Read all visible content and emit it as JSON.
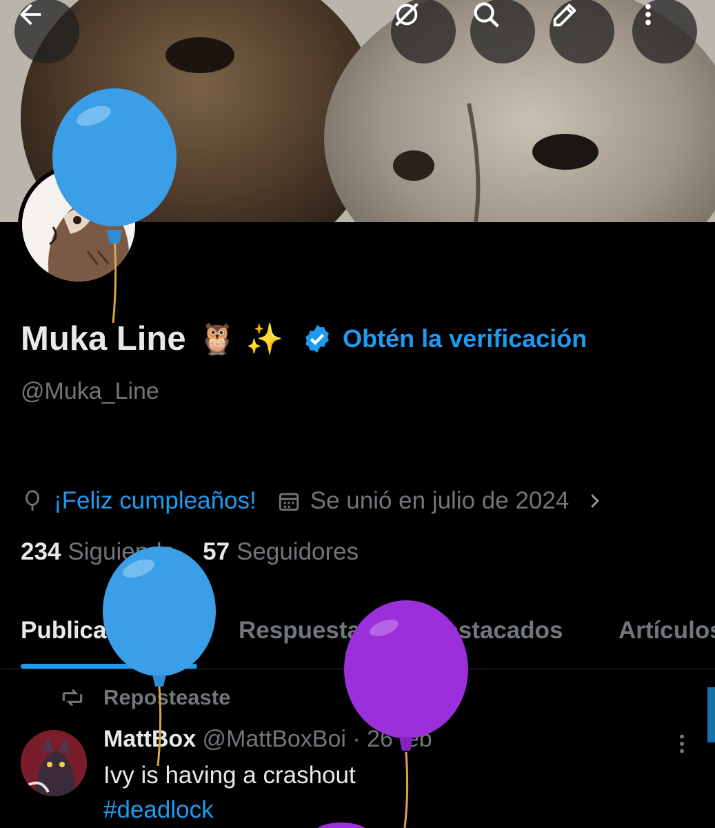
{
  "header": {
    "back_icon": "arrow-left-icon",
    "grok_icon": "grok-icon",
    "search_icon": "search-icon",
    "edit_icon": "edit-icon",
    "more_icon": "more-vertical-icon"
  },
  "profile": {
    "display_name": "Muka Line",
    "name_emoji": "🦉 ✨",
    "verify_link": "Obtén la verificación",
    "handle": "@Muka_Line",
    "birthday_text": "¡Feliz cumpleaños!",
    "joined_text": "Se unió en julio de 2024",
    "following_count": "234",
    "following_label": "Siguiendo",
    "followers_count": "57",
    "followers_label": "Seguidores"
  },
  "tabs": [
    {
      "label": "Publicaciones",
      "active": true
    },
    {
      "label": "Respuestas",
      "active": false
    },
    {
      "label": "Destacados",
      "active": false
    },
    {
      "label": "Artículos",
      "active": false
    }
  ],
  "feed": {
    "repost_label": "Reposteaste",
    "post": {
      "author_name": "MattBox",
      "author_meta": " @MattBoxBoi · 26 feb",
      "text": "Ivy is having a crashout",
      "hashtag": "#deadlock"
    }
  },
  "colors": {
    "accent": "#1d9bf0",
    "secondary_text": "#71767b",
    "primary_text": "#e7e9ea",
    "balloon_blue": "#3b9fe8",
    "balloon_purple": "#9b2fd9"
  }
}
